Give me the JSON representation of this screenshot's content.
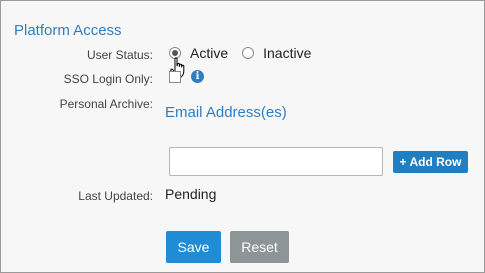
{
  "section": {
    "title": "Platform Access"
  },
  "fields": {
    "user_status_label": "User Status:",
    "sso_login_label": "SSO Login Only:",
    "personal_archive_label": "Personal Archive:",
    "last_updated_label": "Last Updated:"
  },
  "user_status": {
    "options": [
      {
        "label": "Active",
        "selected": true
      },
      {
        "label": "Inactive",
        "selected": false
      }
    ]
  },
  "sso_login": {
    "checked": false,
    "info_icon": "info-icon"
  },
  "personal_archive": {
    "heading": "Email Address(es)",
    "email_value": "",
    "add_row_label": "+ Add Row"
  },
  "last_updated": {
    "value": "Pending"
  },
  "actions": {
    "save_label": "Save",
    "reset_label": "Reset"
  },
  "colors": {
    "accent": "#2f7ec1",
    "primary_button": "#1f8dd6",
    "secondary_button": "#8e9596",
    "panel_background": "#f7f7f7"
  }
}
